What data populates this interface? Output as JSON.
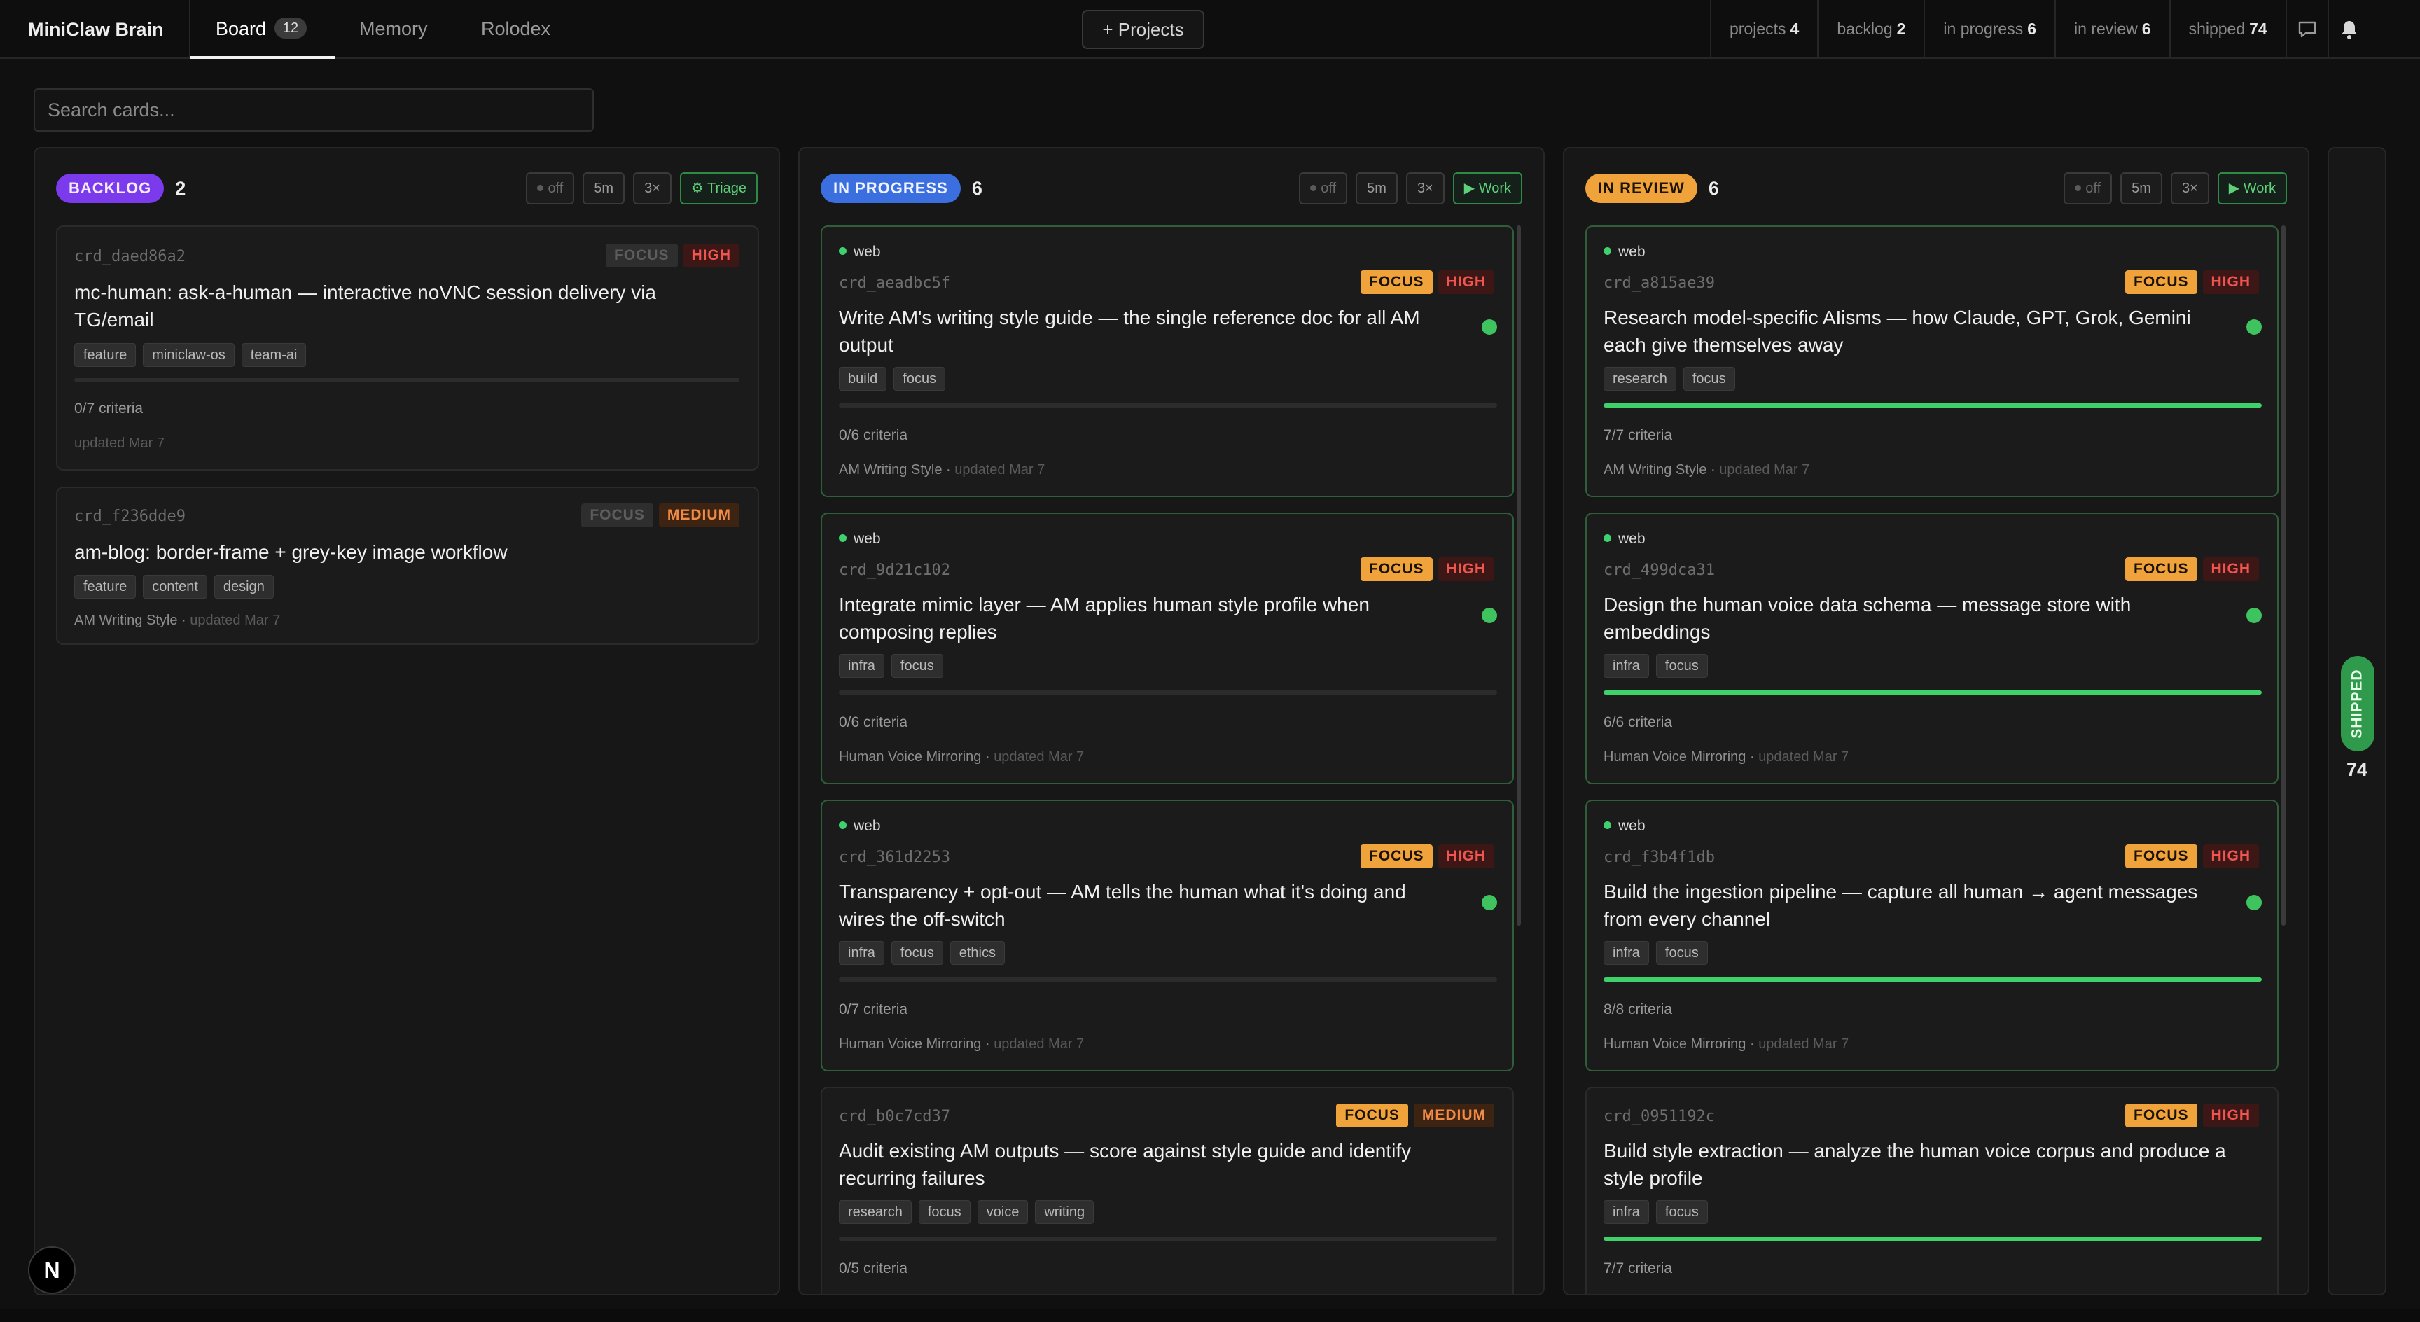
{
  "app": {
    "brand": "MiniClaw Brain"
  },
  "nav": {
    "tabs": [
      {
        "label": "Board",
        "count": "12"
      },
      {
        "label": "Memory"
      },
      {
        "label": "Rolodex"
      }
    ],
    "projects_button": "+ Projects"
  },
  "stats": [
    {
      "label": "projects",
      "value": "4"
    },
    {
      "label": "backlog",
      "value": "2"
    },
    {
      "label": "in progress",
      "value": "6"
    },
    {
      "label": "in review",
      "value": "6"
    },
    {
      "label": "shipped",
      "value": "74"
    }
  ],
  "search": {
    "placeholder": "Search cards..."
  },
  "colors": {
    "backlog": "#7c3aed",
    "in_progress": "#3b6fe0",
    "in_review": "#f0a23b",
    "shipped": "#2f9a4c",
    "focus": "#f0a23b",
    "high": "#f0554f",
    "medium": "#f08a45",
    "live": "#3fd170"
  },
  "columns": [
    {
      "title": "BACKLOG",
      "count": "2",
      "controls": {
        "off": "off",
        "interval": "5m",
        "multiplier": "3×",
        "action": "Triage"
      },
      "cards": [
        {
          "id": "crd_daed86a2",
          "focus": "FOCUS",
          "priority": "HIGH",
          "title_lines": [
            "mc-human: ask-a-human — interactive noVNC session delivery via",
            "TG/email"
          ],
          "tags": [
            "feature",
            "miniclaw-os",
            "team-ai"
          ],
          "progress": 0,
          "criteria": "0/7 criteria",
          "project": "",
          "updated": "updated Mar 7"
        },
        {
          "id": "crd_f236dde9",
          "focus": "FOCUS",
          "priority": "MEDIUM",
          "title_lines": [
            "am-blog: border-frame + grey-key image workflow"
          ],
          "tags": [
            "feature",
            "content",
            "design"
          ],
          "project": "AM Writing Style ·",
          "updated": "updated Mar 7"
        }
      ]
    },
    {
      "title": "IN PROGRESS",
      "count": "6",
      "controls": {
        "off": "off",
        "interval": "5m",
        "multiplier": "3×",
        "action": "Work"
      },
      "cards": [
        {
          "source": "web",
          "id": "crd_aeadbc5f",
          "focus": "FOCUS",
          "priority": "HIGH",
          "title_lines": [
            "Write AM's writing style guide — the single reference doc for all AM",
            "output"
          ],
          "tags": [
            "build",
            "focus"
          ],
          "progress": 0,
          "criteria": "0/6 criteria",
          "project": "AM Writing Style ·",
          "updated": "updated Mar 7"
        },
        {
          "source": "web",
          "id": "crd_9d21c102",
          "focus": "FOCUS",
          "priority": "HIGH",
          "title_lines": [
            "Integrate mimic layer — AM applies human style profile when",
            "composing replies"
          ],
          "tags": [
            "infra",
            "focus"
          ],
          "progress": 0,
          "criteria": "0/6 criteria",
          "project": "Human Voice Mirroring ·",
          "updated": "updated Mar 7"
        },
        {
          "source": "web",
          "id": "crd_361d2253",
          "focus": "FOCUS",
          "priority": "HIGH",
          "title_lines": [
            "Transparency + opt-out — AM tells the human what it's doing and",
            "wires the off-switch"
          ],
          "tags": [
            "infra",
            "focus",
            "ethics"
          ],
          "progress": 0,
          "criteria": "0/7 criteria",
          "project": "Human Voice Mirroring ·",
          "updated": "updated Mar 7"
        },
        {
          "id": "crd_b0c7cd37",
          "focus": "FOCUS",
          "priority": "MEDIUM",
          "title_lines": [
            "Audit existing AM outputs — score against style guide and identify",
            "recurring failures"
          ],
          "tags": [
            "research",
            "focus",
            "voice",
            "writing"
          ],
          "progress": 0,
          "criteria": "0/5 criteria"
        }
      ]
    },
    {
      "title": "IN REVIEW",
      "count": "6",
      "controls": {
        "off": "off",
        "interval": "5m",
        "multiplier": "3×",
        "action": "Work"
      },
      "cards": [
        {
          "source": "web",
          "id": "crd_a815ae39",
          "focus": "FOCUS",
          "priority": "HIGH",
          "title_lines": [
            "Research model-specific AIisms — how Claude, GPT, Grok, Gemini",
            "each give themselves away"
          ],
          "tags": [
            "research",
            "focus"
          ],
          "progress": 1,
          "criteria": "7/7 criteria",
          "project": "AM Writing Style ·",
          "updated": "updated Mar 7"
        },
        {
          "source": "web",
          "id": "crd_499dca31",
          "focus": "FOCUS",
          "priority": "HIGH",
          "title_lines": [
            "Design the human voice data schema — message store with",
            "embeddings"
          ],
          "tags": [
            "infra",
            "focus"
          ],
          "progress": 1,
          "criteria": "6/6 criteria",
          "project": "Human Voice Mirroring ·",
          "updated": "updated Mar 7"
        },
        {
          "source": "web",
          "id": "crd_f3b4f1db",
          "focus": "FOCUS",
          "priority": "HIGH",
          "title_lines": [
            "Build the ingestion pipeline — capture all human → agent messages",
            "from every channel"
          ],
          "tags": [
            "infra",
            "focus"
          ],
          "progress": 1,
          "criteria": "8/8 criteria",
          "project": "Human Voice Mirroring ·",
          "updated": "updated Mar 7"
        },
        {
          "id": "crd_0951192c",
          "focus": "FOCUS",
          "priority": "HIGH",
          "title_lines": [
            "Build style extraction — analyze the human voice corpus and produce a",
            "style profile"
          ],
          "tags": [
            "infra",
            "focus"
          ],
          "progress": 1,
          "criteria": "7/7 criteria"
        }
      ]
    }
  ],
  "shipped": {
    "label": "SHIPPED",
    "count": "74"
  },
  "footer": {
    "logo_letter": "N"
  }
}
